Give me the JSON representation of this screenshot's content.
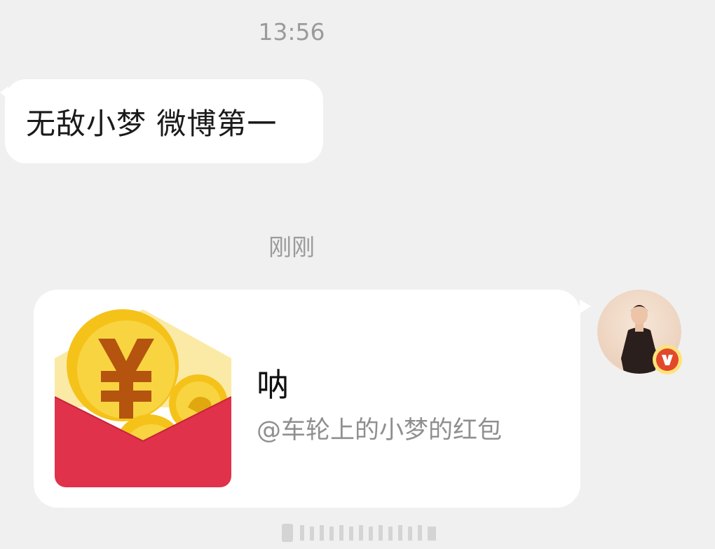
{
  "chat": {
    "timestamp_1": "13:56",
    "message_1": "无敌小梦 微博第一",
    "timestamp_2": "刚刚",
    "red_packet": {
      "title": "呐",
      "subtitle": "@车轮上的小梦的红包",
      "icon": "red-envelope-icon"
    },
    "sender": {
      "verified_badge": "V",
      "badge_color": "#e2492a"
    }
  },
  "colors": {
    "background": "#f0f0f0",
    "bubble": "#ffffff",
    "envelope_red": "#e0324a",
    "coin_gold": "#f5c21a",
    "coin_symbol": "#b4540f"
  }
}
